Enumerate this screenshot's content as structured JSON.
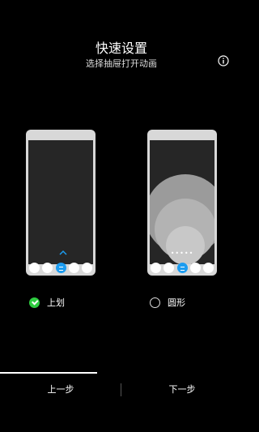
{
  "header": {
    "title": "快速设置",
    "subtitle": "选择抽屉打开动画",
    "info_icon": "info-icon"
  },
  "options": [
    {
      "label": "上划",
      "selected": true,
      "preview": "swipe-up"
    },
    {
      "label": "圆形",
      "selected": false,
      "preview": "circle"
    }
  ],
  "preview_right": {
    "dots": "•••••"
  },
  "footer": {
    "prev_label": "上一步",
    "next_label": "下一步"
  },
  "colors": {
    "background": "#000000",
    "accent_blue": "#1c9cf0",
    "check_green": "#2ecc40"
  }
}
